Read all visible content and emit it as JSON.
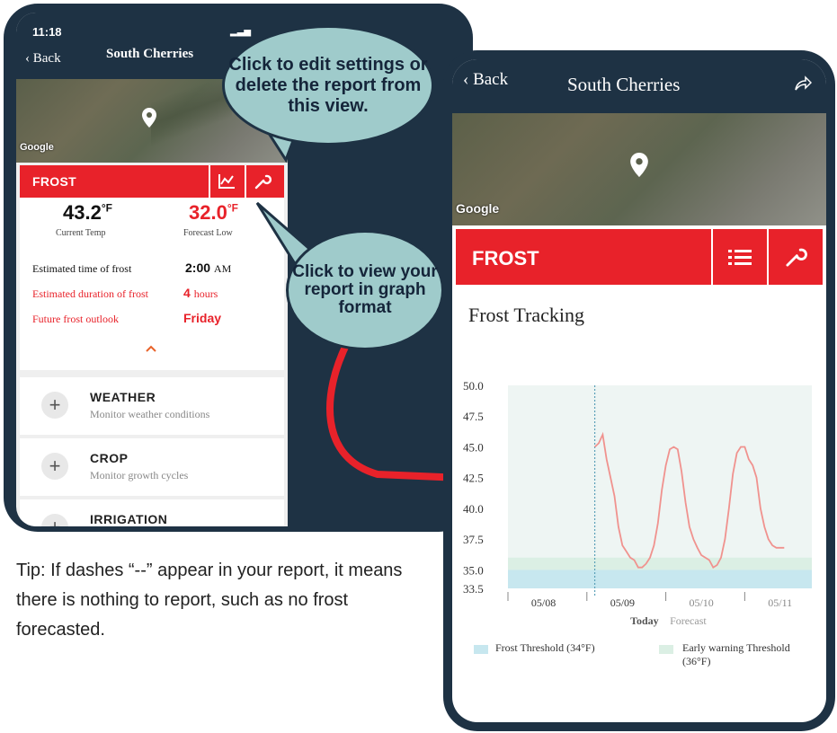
{
  "phone1": {
    "status_time": "11:18",
    "back_label": "Back",
    "title": "South Cherries",
    "map_credit": "Google",
    "frost": {
      "label": "FROST",
      "current_temp": "43.2",
      "current_unit": "°F",
      "current_label": "Current Temp",
      "forecast_low": "32.0",
      "forecast_unit": "°F",
      "forecast_label": "Forecast Low",
      "rows": [
        {
          "label": "Estimated time of frost",
          "value": "2:00",
          "suffix": "AM"
        },
        {
          "label": "Estimated duration of frost",
          "value": "4",
          "suffix": "hours"
        },
        {
          "label": "Future frost outlook",
          "value": "Friday",
          "suffix": ""
        }
      ]
    },
    "sections": [
      {
        "title": "WEATHER",
        "subtitle": "Monitor weather conditions"
      },
      {
        "title": "CROP",
        "subtitle": "Monitor growth cycles"
      },
      {
        "title": "IRRIGATION",
        "subtitle": ""
      }
    ]
  },
  "callouts": {
    "settings": "Click to edit settings or delete the report from this view.",
    "graph": "Click to view your report in graph format"
  },
  "phone2": {
    "back_label": "Back",
    "title": "South Cherries",
    "map_credit": "Google",
    "frost_label": "FROST",
    "chart_title": "Frost Tracking",
    "today_label": "Today",
    "forecast_label": "Forecast",
    "legend": [
      {
        "label": "Frost Threshold (34°F)",
        "color": "#c7e7ef"
      },
      {
        "label": "Early warning Threshold (36°F)",
        "color": "#dbefe4"
      }
    ]
  },
  "tip": "Tip: If dashes “--” appear in your report, it means there is nothing to report, such as no frost forecasted.",
  "colors": {
    "accent": "#e8222a",
    "navy": "#1e3244",
    "bubble": "#9fcbcb",
    "line": "#f0928e"
  },
  "chart_data": {
    "type": "line",
    "title": "Frost Tracking",
    "xlabel": "",
    "ylabel": "",
    "ylim": [
      33.5,
      50.0
    ],
    "yticks": [
      "50.0",
      "47.5",
      "45.0",
      "42.5",
      "40.0",
      "37.5",
      "35.0",
      "33.5"
    ],
    "xticks": [
      "05/08",
      "05/09",
      "05/10",
      "05/11"
    ],
    "today_x": 1.1,
    "thresholds": [
      {
        "name": "Frost Threshold (34°F)",
        "value": 34.0
      },
      {
        "name": "Early warning Threshold (36°F)",
        "value": 36.0
      }
    ],
    "series": [
      {
        "x": [
          1.1,
          1.15,
          1.2,
          1.25,
          1.3,
          1.35,
          1.4,
          1.45,
          1.5,
          1.55,
          1.6,
          1.65,
          1.7,
          1.75,
          1.8,
          1.85,
          1.9,
          1.95,
          2.0,
          2.05,
          2.1,
          2.15,
          2.2,
          2.25,
          2.3,
          2.35,
          2.4,
          2.45,
          2.5,
          2.55,
          2.6,
          2.65,
          2.7,
          2.75,
          2.8,
          2.85,
          2.9,
          2.95,
          3.0,
          3.05,
          3.1,
          3.15,
          3.2,
          3.25,
          3.3,
          3.35,
          3.4,
          3.45,
          3.5
        ],
        "values": [
          45.0,
          45.3,
          46.0,
          44.0,
          42.5,
          41.0,
          38.5,
          37.0,
          36.5,
          36.0,
          35.8,
          35.2,
          35.2,
          35.5,
          36.0,
          37.0,
          38.8,
          41.5,
          43.5,
          44.8,
          45.0,
          44.8,
          43.0,
          40.5,
          38.5,
          37.5,
          36.8,
          36.2,
          36.0,
          35.8,
          35.2,
          35.4,
          36.0,
          37.5,
          40.0,
          42.8,
          44.5,
          45.0,
          45.0,
          44.0,
          43.5,
          42.5,
          40.0,
          38.5,
          37.5,
          37.0,
          36.8,
          36.8,
          36.8
        ]
      }
    ]
  }
}
